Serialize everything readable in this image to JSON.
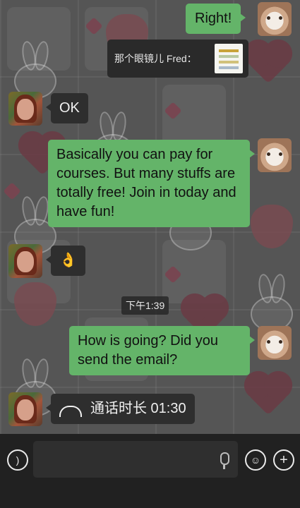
{
  "messages": {
    "m1": {
      "text": "Right!"
    },
    "m2": {
      "quote": "那个眼镜儿 Fred："
    },
    "m3": {
      "text": "OK"
    },
    "m4": {
      "text": "Basically you can pay for courses. But  many stuffs are totally free! Join in today and have fun!"
    },
    "m5": {
      "text": "👌"
    },
    "time": "下午1:39",
    "m6": {
      "text": "How is going? Did you send the email?"
    },
    "m7": {
      "label": "通话时长 01:30"
    }
  },
  "input_bar": {
    "voice_icon": "voice-icon",
    "emoji_icon": "emoji-icon",
    "add_icon": "add-icon",
    "mic_icon": "mic-icon"
  },
  "colors": {
    "sent_bubble": "#64b469",
    "received_bubble": "#2e2e2e",
    "input_bar": "#212121"
  }
}
